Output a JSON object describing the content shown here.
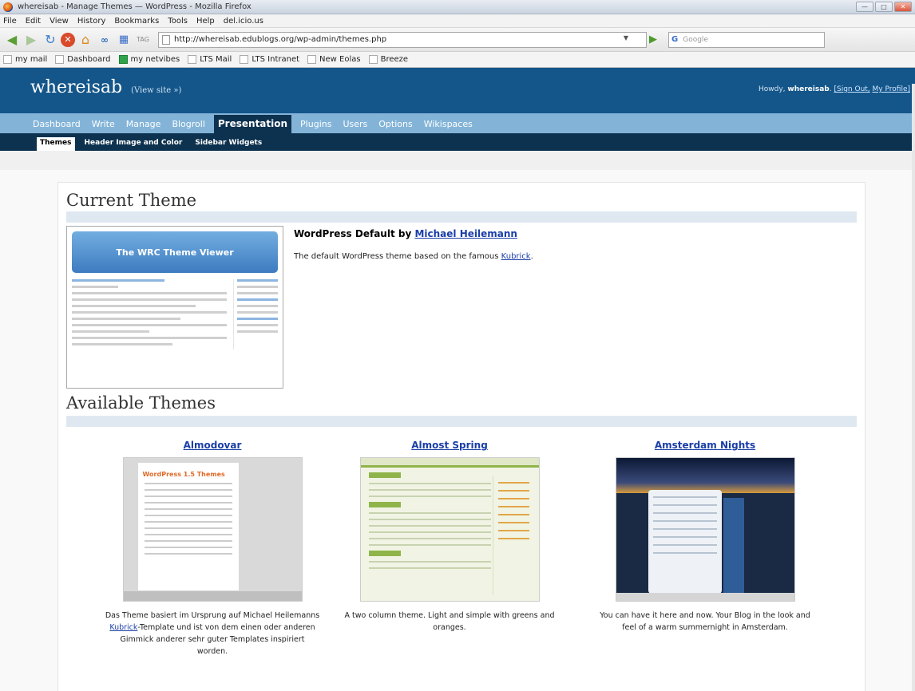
{
  "window": {
    "title": "whereisab - Manage Themes — WordPress - Mozilla Firefox",
    "buttons": [
      "—",
      "□",
      "✕"
    ]
  },
  "menu": [
    "File",
    "Edit",
    "View",
    "History",
    "Bookmarks",
    "Tools",
    "Help",
    "del.icio.us"
  ],
  "toolbar": {
    "url": "http://whereisab.edublogs.org/wp-admin/themes.php",
    "search_placeholder": "Google",
    "search_engine": "G"
  },
  "bookmarks": [
    "my mail",
    "Dashboard",
    "my netvibes",
    "LTS Mail",
    "LTS Intranet",
    "New Eolas",
    "Breeze"
  ],
  "wp": {
    "blog_name": "whereisab",
    "view_site": "(View site »)",
    "howdy_prefix": "Howdy,",
    "user": "whereisab",
    "sign_out": "[Sign Out,",
    "my_profile": "My Profile]",
    "menu": [
      "Dashboard",
      "Write",
      "Manage",
      "Blogroll",
      "Presentation",
      "Plugins",
      "Users",
      "Options",
      "Wikispaces"
    ],
    "active_menu": "Presentation",
    "submenu": [
      "Themes",
      "Header Image and Color",
      "Sidebar Widgets"
    ],
    "active_submenu": "Themes",
    "current_heading": "Current Theme",
    "current_shot_title": "The WRC Theme Viewer",
    "current_theme_name": "WordPress Default by",
    "current_theme_author": "Michael Heilemann",
    "current_theme_desc_prefix": "The default WordPress theme based on the famous",
    "current_theme_desc_link": "Kubrick",
    "current_theme_desc_suffix": ".",
    "available_heading": "Available Themes",
    "themes": [
      {
        "name": "Almodovar",
        "shot_title": "WordPress 1.5 Themes",
        "desc_a": "Das Theme basiert im Ursprung auf Michael Heilemanns",
        "desc_link": "Kubrick",
        "desc_b": "-Template und ist von dem einen oder anderen Gimmick anderer sehr guter Templates inspiriert worden."
      },
      {
        "name": "Almost Spring",
        "desc": "A two column theme. Light and simple with greens and oranges."
      },
      {
        "name": "Amsterdam Nights",
        "desc": "You can have it here and now. Your Blog in the look and feel of a warm summernight in Amsterdam."
      }
    ]
  },
  "colors": {
    "header_bg": "#14568a",
    "menu_bg": "#83b4d8",
    "submenu_bg": "#0d324f",
    "link": "#1a3ea8"
  }
}
